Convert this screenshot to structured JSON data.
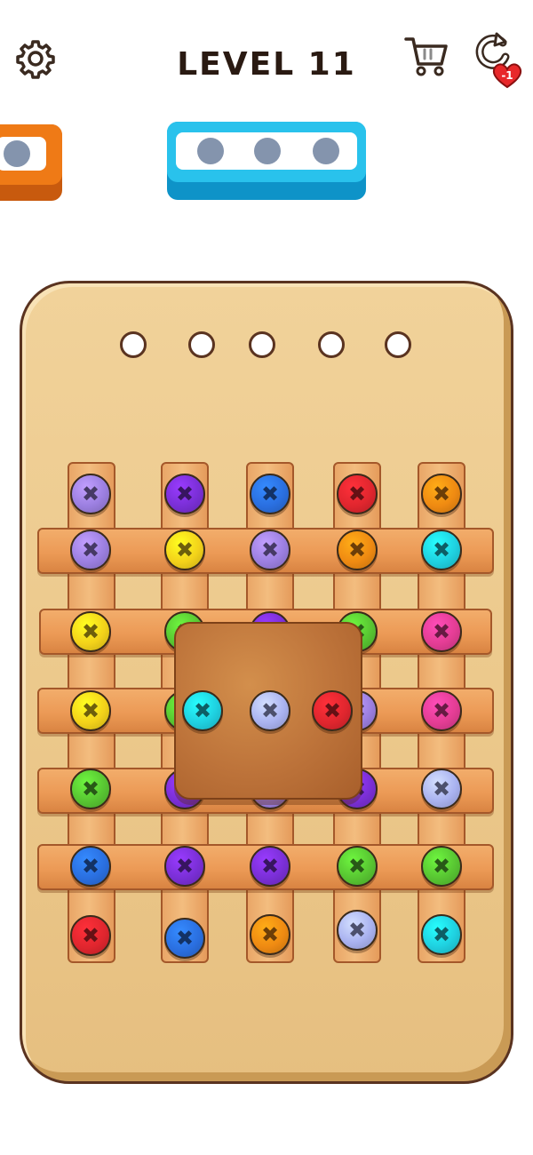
{
  "header": {
    "level_title": "LEVEL 11",
    "undo_badge": "-1",
    "settings_icon": "gear-icon",
    "shop_icon": "cart-icon",
    "undo_icon": "undo-icon"
  },
  "holders": [
    {
      "color": "orange",
      "visible_holes": 1
    },
    {
      "color": "cyan",
      "visible_holes": 3
    }
  ],
  "board": {
    "empty_holes": 5,
    "vertical_planks": 5,
    "horizontal_planks": 5,
    "center_square": true
  },
  "screws": {
    "column_tops": [
      "lavender",
      "purple",
      "blue",
      "red",
      "orange"
    ],
    "row_1": [
      "lavender",
      "yellow",
      "lavender",
      "orange",
      "cyan"
    ],
    "row_2": [
      "yellow",
      "green",
      "purple",
      "green",
      "pink"
    ],
    "row_3": [
      "yellow",
      "green",
      "lavender",
      "pink"
    ],
    "row_4": [
      "green",
      "purple",
      "lavender",
      "purple",
      "periwinkle"
    ],
    "row_5": [
      "blue",
      "purple",
      "purple",
      "green",
      "green"
    ],
    "column_bottoms": [
      "red",
      "blue",
      "orange",
      "periwinkle",
      "cyan"
    ],
    "square_screws": [
      "cyan",
      "periwinkle",
      "red"
    ]
  },
  "colors": {
    "lavender": "#9b7fe0",
    "purple": "#7a2fd6",
    "blue": "#2a6fe0",
    "red": "#e0262e",
    "orange": "#ef8a12",
    "yellow": "#f3d21a",
    "cyan": "#1fd0e0",
    "green": "#58c532",
    "pink": "#e43d94",
    "periwinkle": "#a9b2f0",
    "holder_orange": "#ef7a16",
    "holder_cyan": "#29c2ec",
    "hole_gray": "#8494ad",
    "board_wood": "#ecc98c"
  }
}
